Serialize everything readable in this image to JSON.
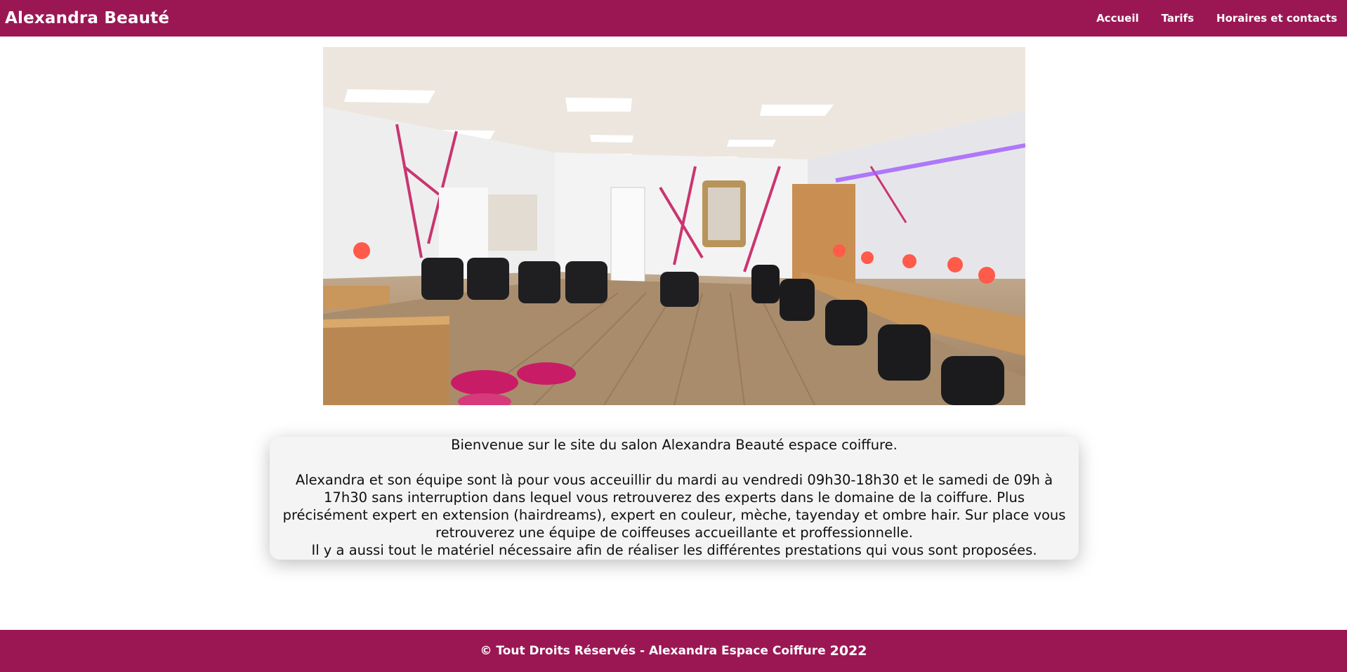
{
  "header": {
    "brand": "Alexandra Beauté",
    "nav": [
      {
        "label": "Accueil"
      },
      {
        "label": "Tarifs"
      },
      {
        "label": "Horaires et contacts"
      }
    ]
  },
  "hero": {
    "image_description_icon": "salon-photo"
  },
  "welcome": {
    "intro": "Bienvenue sur le site du salon Alexandra Beauté espace coiffure.",
    "body": "Alexandra et son équipe sont là pour vous acceuillir du mardi au vendredi 09h30-18h30 et le samedi de 09h à 17h30 sans interruption dans lequel vous retrouverez des experts dans le domaine de la coiffure. Plus précisément expert en extension (hairdreams), expert en couleur, mèche, tayenday et ombre hair. Sur place vous retrouverez une équipe de coiffeuses accueillante et proffessionnelle.",
    "closing": "Il y a aussi tout le matériel nécessaire afin de réaliser les différentes prestations qui vous sont proposées."
  },
  "footer": {
    "text": "© Tout Droits Réservés - Alexandra Espace Coiffure",
    "year": "2022"
  },
  "colors": {
    "brand": "#9b1754",
    "panel": "#f4f4f4"
  }
}
